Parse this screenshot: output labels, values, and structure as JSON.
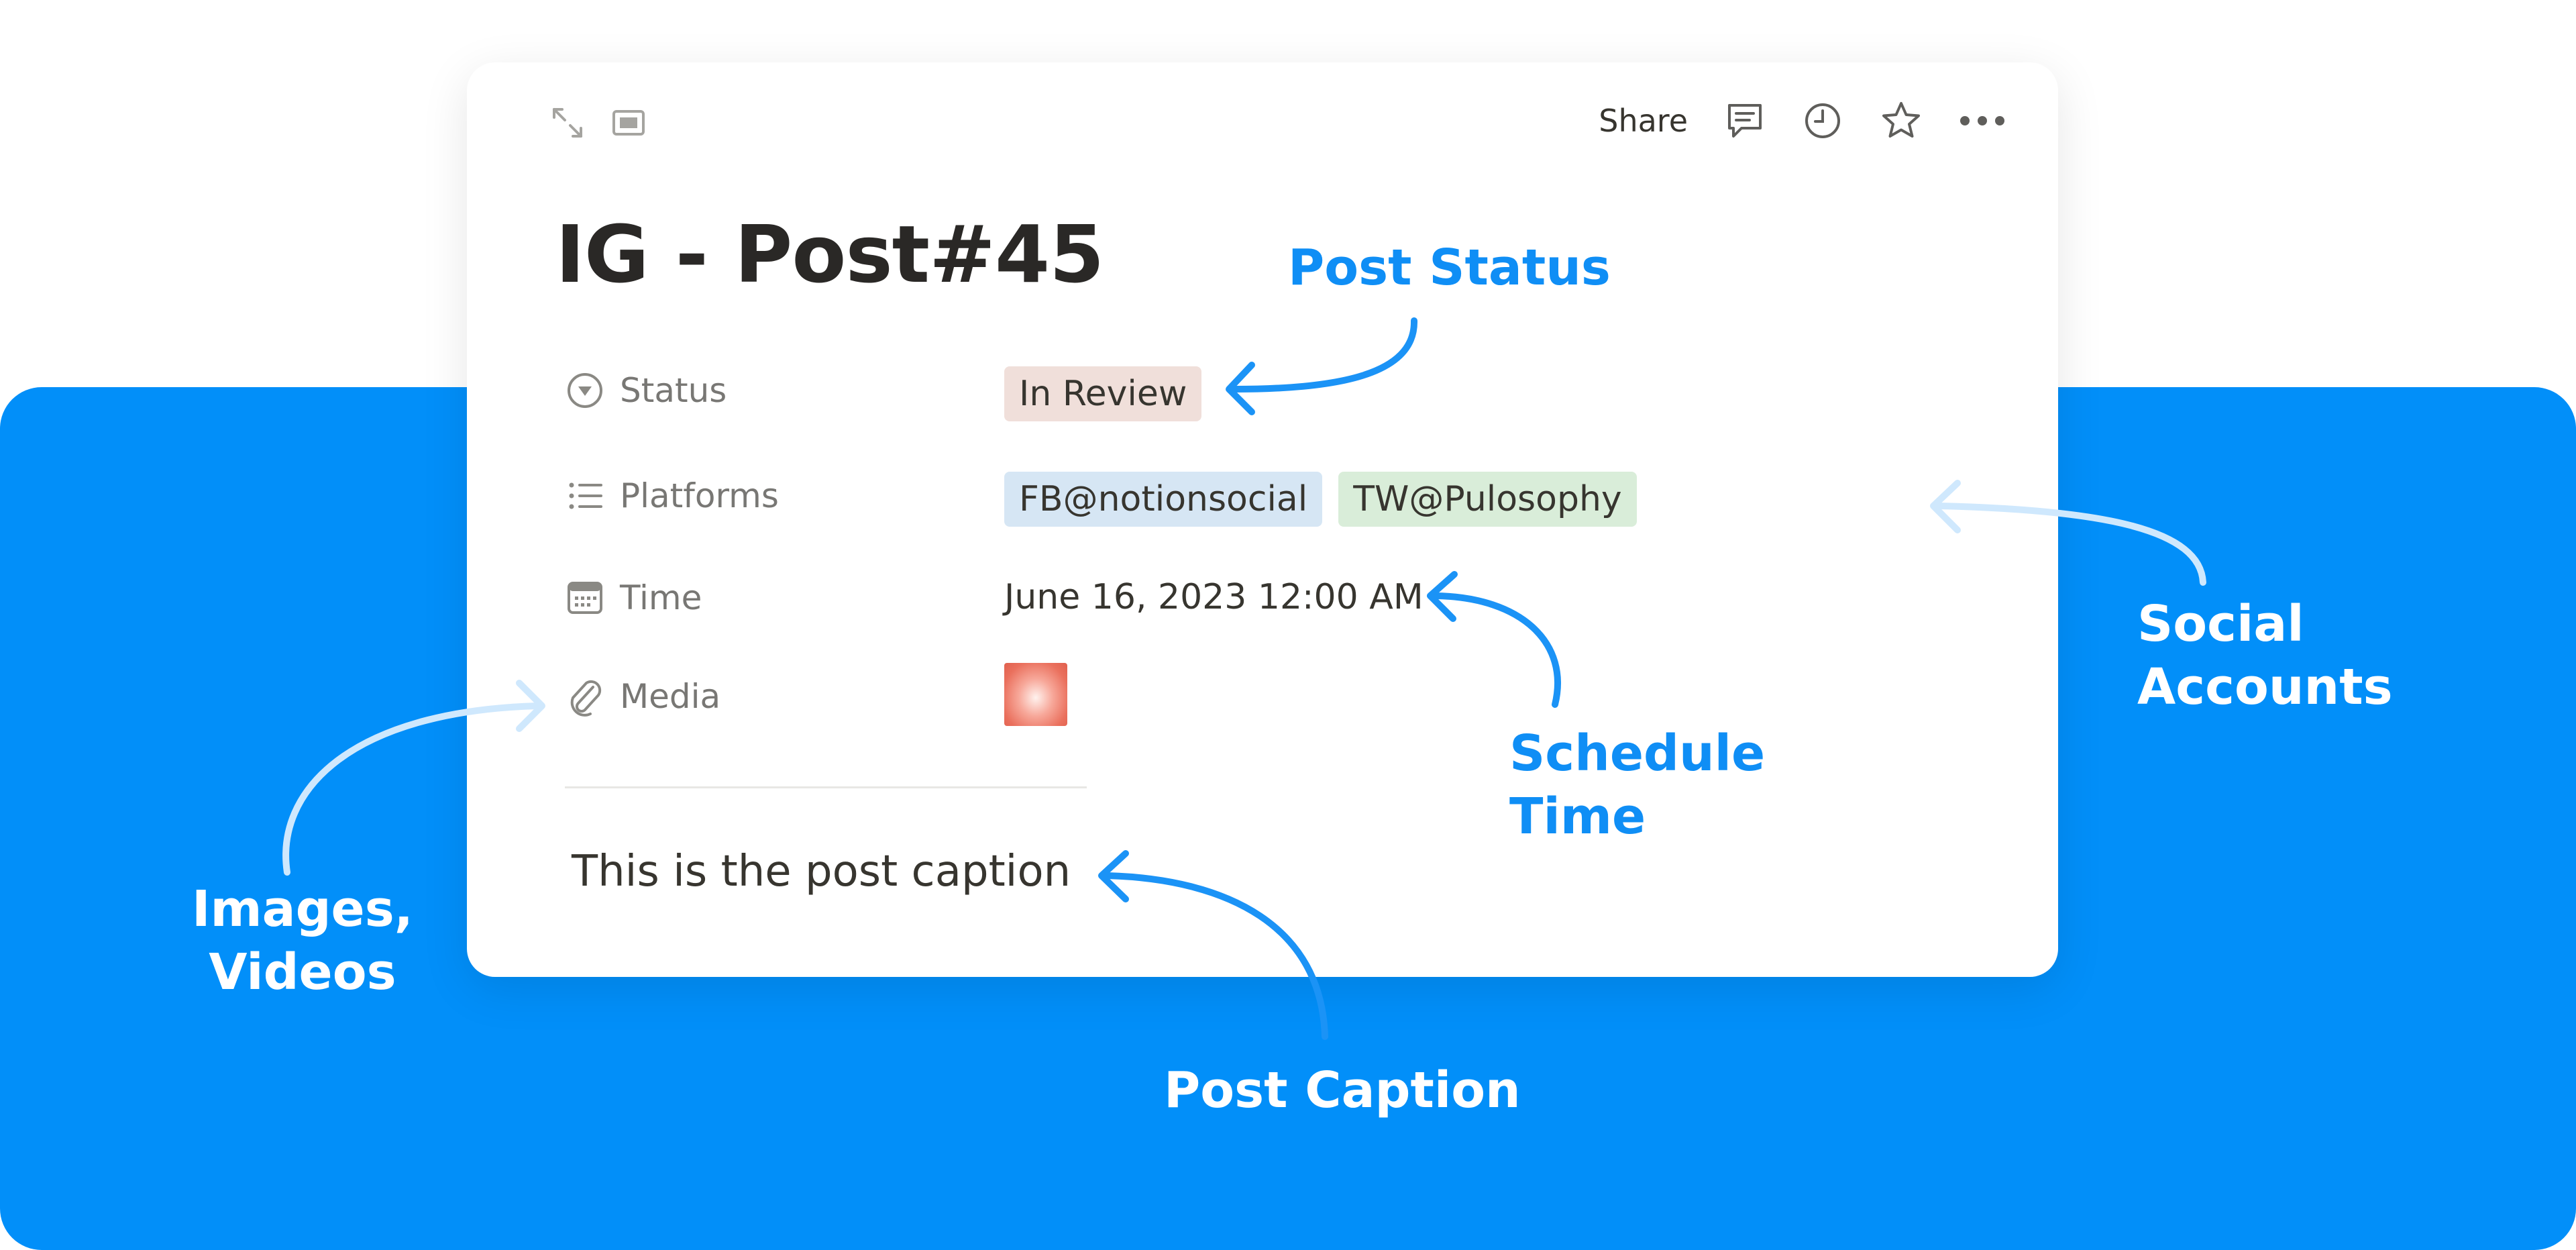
{
  "page": {
    "title": "IG - Post#45"
  },
  "toolbar": {
    "share_label": "Share"
  },
  "properties": {
    "status": {
      "label": "Status",
      "value": "In Review"
    },
    "platforms": {
      "label": "Platforms",
      "values": [
        "FB@notionsocial",
        "TW@Pulosophy"
      ]
    },
    "time": {
      "label": "Time",
      "value": "June 16, 2023 12:00 AM"
    },
    "media": {
      "label": "Media"
    }
  },
  "body": {
    "caption": "This is the post caption"
  },
  "annotations": {
    "post_status": "Post Status",
    "social_accounts": [
      "Social",
      "Accounts"
    ],
    "schedule_time": [
      "Schedule",
      "Time"
    ],
    "images_videos": [
      "Images,",
      "Videos"
    ],
    "post_caption": "Post Caption"
  },
  "colors": {
    "background_blue": "#028ff9",
    "annotation_blue": "#0f8ef5",
    "tag_status": "#f0dfda",
    "tag_fb": "#d6e6f4",
    "tag_tw": "#d9edd9"
  },
  "icons": [
    "expand-icon",
    "sidebar-icon",
    "comment-icon",
    "history-icon",
    "star-icon",
    "more-icon",
    "status-icon",
    "list-icon",
    "calendar-icon",
    "attachment-icon"
  ]
}
